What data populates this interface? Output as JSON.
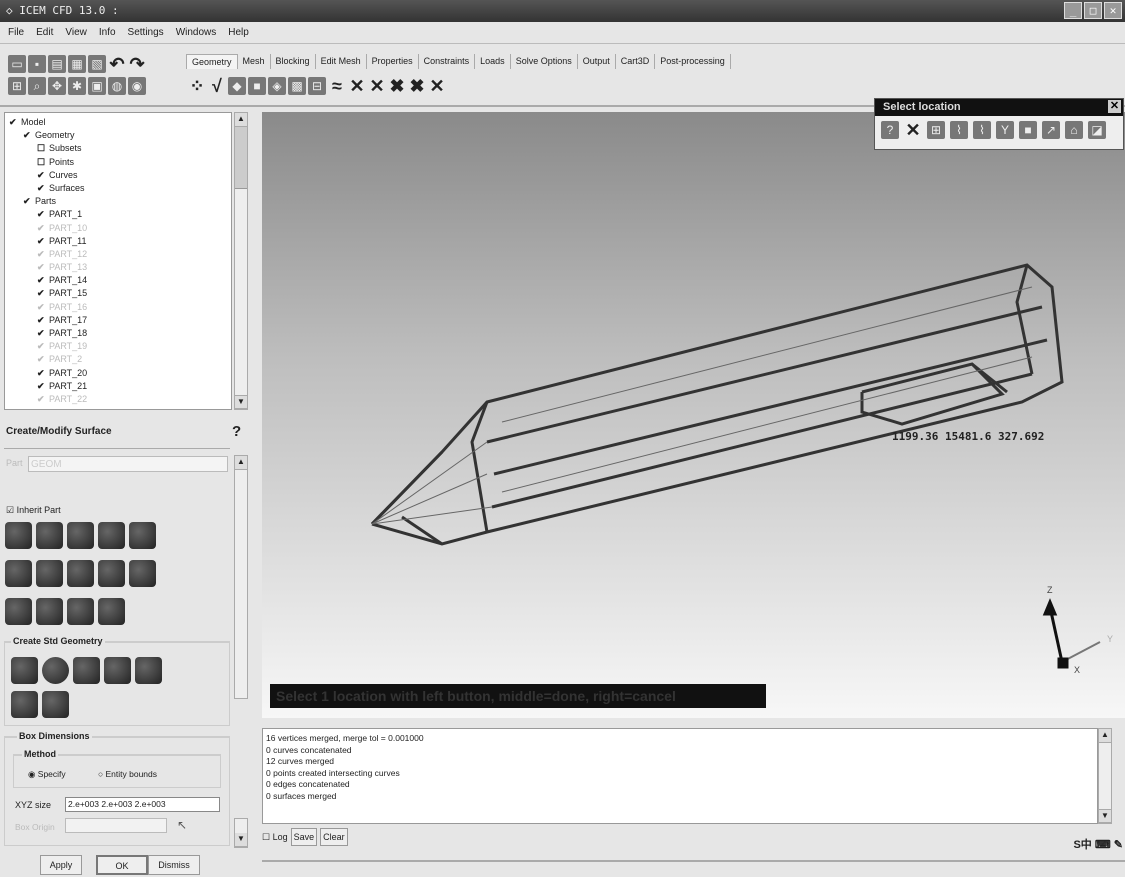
{
  "title": "ICEM CFD 13.0 :",
  "menu": [
    "File",
    "Edit",
    "View",
    "Info",
    "Settings",
    "Windows",
    "Help"
  ],
  "tabs": [
    "Geometry",
    "Mesh",
    "Blocking",
    "Edit Mesh",
    "Properties",
    "Constraints",
    "Loads",
    "Solve Options",
    "Output",
    "Cart3D",
    "Post-processing"
  ],
  "tree": [
    {
      "label": "Model",
      "level": 0,
      "checked": true,
      "dim": false
    },
    {
      "label": "Geometry",
      "level": 1,
      "checked": true,
      "dim": false
    },
    {
      "label": "Subsets",
      "level": 2,
      "checked": false,
      "dim": false
    },
    {
      "label": "Points",
      "level": 2,
      "checked": false,
      "dim": false
    },
    {
      "label": "Curves",
      "level": 2,
      "checked": true,
      "dim": false
    },
    {
      "label": "Surfaces",
      "level": 2,
      "checked": true,
      "dim": false
    },
    {
      "label": "Parts",
      "level": 1,
      "checked": true,
      "dim": false
    },
    {
      "label": "PART_1",
      "level": 2,
      "checked": true,
      "dim": false
    },
    {
      "label": "PART_10",
      "level": 2,
      "checked": true,
      "dim": true
    },
    {
      "label": "PART_11",
      "level": 2,
      "checked": true,
      "dim": false
    },
    {
      "label": "PART_12",
      "level": 2,
      "checked": true,
      "dim": true
    },
    {
      "label": "PART_13",
      "level": 2,
      "checked": true,
      "dim": true
    },
    {
      "label": "PART_14",
      "level": 2,
      "checked": true,
      "dim": false
    },
    {
      "label": "PART_15",
      "level": 2,
      "checked": true,
      "dim": false
    },
    {
      "label": "PART_16",
      "level": 2,
      "checked": true,
      "dim": true
    },
    {
      "label": "PART_17",
      "level": 2,
      "checked": true,
      "dim": false
    },
    {
      "label": "PART_18",
      "level": 2,
      "checked": true,
      "dim": false
    },
    {
      "label": "PART_19",
      "level": 2,
      "checked": true,
      "dim": true
    },
    {
      "label": "PART_2",
      "level": 2,
      "checked": true,
      "dim": true
    },
    {
      "label": "PART_20",
      "level": 2,
      "checked": true,
      "dim": false
    },
    {
      "label": "PART_21",
      "level": 2,
      "checked": true,
      "dim": false
    },
    {
      "label": "PART_22",
      "level": 2,
      "checked": true,
      "dim": true
    }
  ],
  "panel": {
    "title": "Create/Modify Surface",
    "part_label": "Part",
    "part_value": "GEOM",
    "inherit_part": "Inherit Part",
    "std_geometry": "Create Std Geometry",
    "box_dimensions": "Box Dimensions",
    "method": "Method",
    "specify": "Specify",
    "entity_bounds": "Entity bounds",
    "xyz_label": "XYZ size",
    "xyz_value": "2.e+003 2.e+003 2.e+003",
    "box_origin": "Box Origin",
    "apply": "Apply",
    "ok": "OK",
    "dismiss": "Dismiss"
  },
  "select_location": {
    "title": "Select location",
    "close": "✕"
  },
  "viewport": {
    "coords": "1199.36 15481.6 327.692",
    "prompt": "Select 1 location with left button, middle=done, right=cancel",
    "axis": {
      "z": "Z",
      "y": "Y",
      "x": "X"
    }
  },
  "messages": [
    "16 vertices merged, merge tol = 0.001000",
    "0 curves concatenated",
    "12 curves merged",
    "0 points created intersecting curves",
    "0 edges concatenated",
    "0 surfaces merged"
  ],
  "bottom": {
    "log": "Log",
    "save": "Save",
    "clear": "Clear",
    "ime": "S中 ⌨ ✎"
  }
}
